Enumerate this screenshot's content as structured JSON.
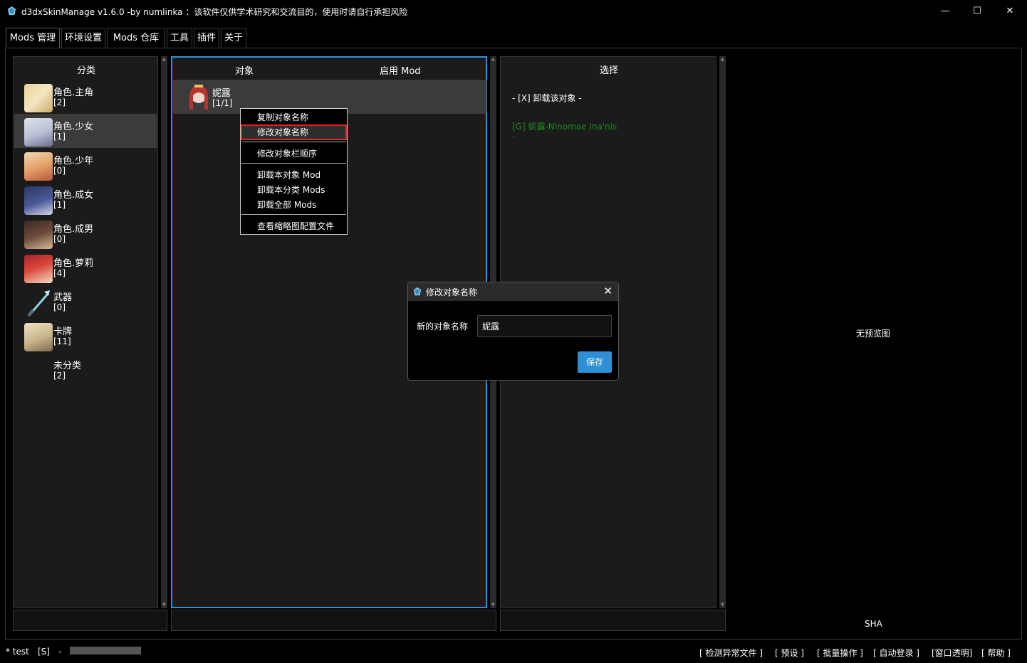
{
  "window": {
    "title": "d3dxSkinManage v1.6.0 -by numlinka ：该软件仅供学术研究和交流目的，使用时请自行承担风险",
    "minimize": "—",
    "maximize": "☐",
    "close": "✕"
  },
  "tabs": [
    "Mods 管理",
    "环境设置",
    "Mods 仓库",
    "工具",
    "插件",
    "关于"
  ],
  "category_panel": {
    "header": "分类",
    "items": [
      {
        "name": "角色.主角",
        "count": "[2]"
      },
      {
        "name": "角色.少女",
        "count": "[1]"
      },
      {
        "name": "角色.少年",
        "count": "[0]"
      },
      {
        "name": "角色.成女",
        "count": "[1]"
      },
      {
        "name": "角色.成男",
        "count": "[0]"
      },
      {
        "name": "角色.萝莉",
        "count": "[4]"
      },
      {
        "name": "武器",
        "count": "[0]"
      },
      {
        "name": "卡牌",
        "count": "[11]"
      },
      {
        "name": "未分类",
        "count": "[2]"
      }
    ]
  },
  "object_panel": {
    "header_object": "对象",
    "header_enabled": "启用 Mod",
    "rows": [
      {
        "name": "妮露",
        "count": "[1/1]"
      }
    ]
  },
  "context_menu": {
    "items": [
      "复制对象名称",
      "修改对象名称",
      "修改对象栏顺序",
      "卸载本对象 Mod",
      "卸载本分类 Mods",
      "卸载全部 Mods",
      "查看缩略图配置文件"
    ],
    "highlighted": "修改对象名称"
  },
  "select_panel": {
    "header": "选择",
    "unload_option": "- [X] 卸载该对象 -",
    "mod_option": "[G] 妮露-Ninomae Ina'nis",
    "mod_option_desc": "-",
    "mod_color": "#1f8a1f"
  },
  "preview": {
    "no_preview": "无预览图",
    "sha": "SHA"
  },
  "dialog": {
    "title": "修改对象名称",
    "label": "新的对象名称",
    "value": "妮露",
    "save": "保存",
    "close": "✕"
  },
  "statusbar": {
    "left": [
      "* test",
      "[S]",
      "-"
    ],
    "links": [
      "[ 检测异常文件 ]",
      "[ 预设 ]",
      "[ 批量操作 ]",
      "[ 自动登录 ]",
      "[窗口透明]",
      "[ 帮助 ]"
    ]
  },
  "colors": {
    "accent": "#2e8fd6",
    "selection_border": "#2e8fd6",
    "highlight_outline": "#e02424"
  }
}
